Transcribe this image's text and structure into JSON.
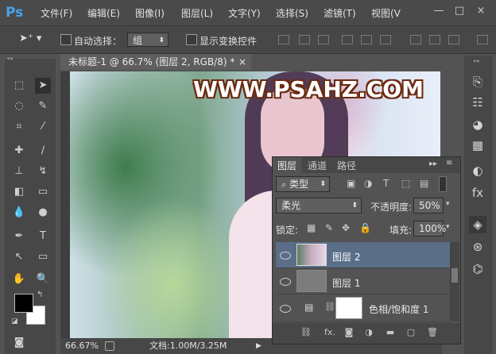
{
  "app": {
    "logo": "Ps"
  },
  "menu": [
    "文件(F)",
    "编辑(E)",
    "图像(I)",
    "图层(L)",
    "文字(Y)",
    "选择(S)",
    "滤镜(T)",
    "视图(V"
  ],
  "window_controls": [
    "—",
    "□",
    "×"
  ],
  "options": {
    "auto_select_label": "自动选择：",
    "auto_select_value": "组",
    "show_transform_label": "显示变换控件"
  },
  "document": {
    "tab_title": "未标题-1 @ 66.7% (图层 2, RGB/8) *",
    "close": "×",
    "watermark": "WWW.PSAHZ.COM"
  },
  "status": {
    "zoom": "66.67%",
    "doc_info": "文档:1.00M/3.25M"
  },
  "layers_panel": {
    "tabs": [
      "图层",
      "通道",
      "路径"
    ],
    "filter_type": "类型",
    "blend_mode": "柔光",
    "opacity_label": "不透明度:",
    "opacity_value": "50%",
    "lock_label": "锁定:",
    "fill_label": "填充:",
    "fill_value": "100%",
    "layers": [
      {
        "name": "图层 2",
        "selected": true
      },
      {
        "name": "图层 1",
        "selected": false
      },
      {
        "name": "色相/饱和度 1",
        "selected": false
      }
    ],
    "bottom_fx": "fx."
  },
  "colors": {
    "accent": "#4ba3e6",
    "selected_layer": "#5a6e87",
    "foreground": "#000000",
    "background": "#ffffff"
  }
}
